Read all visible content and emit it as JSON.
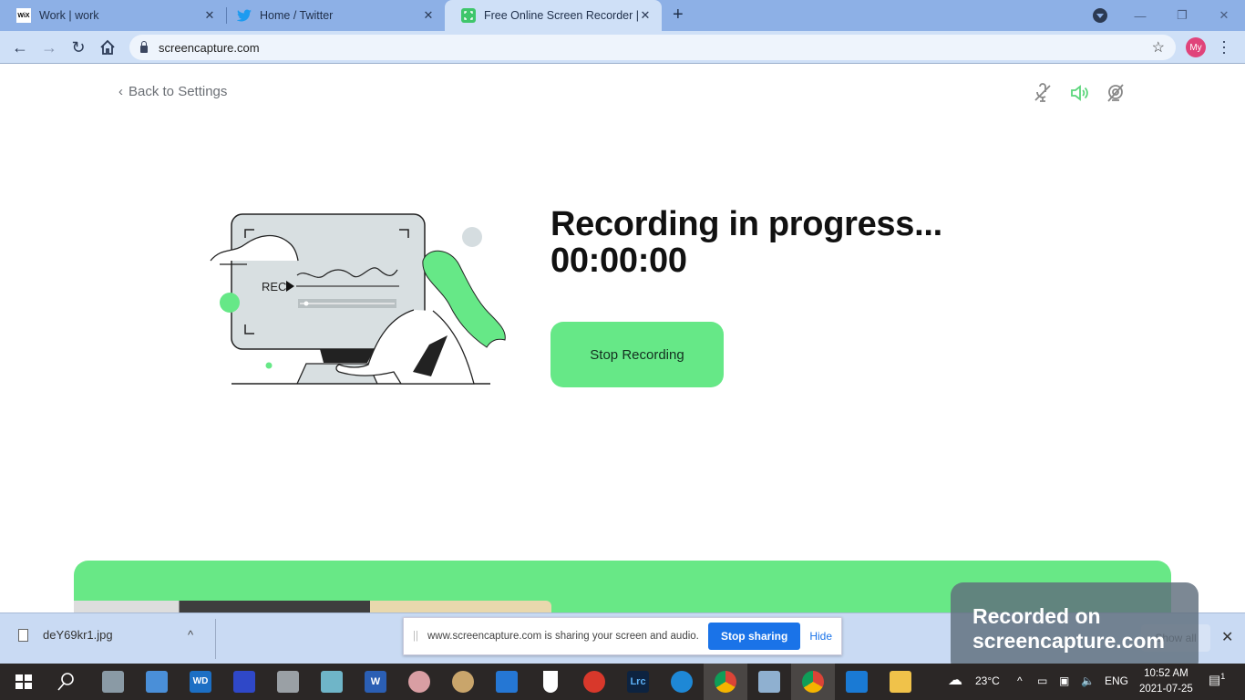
{
  "browser": {
    "tabs": [
      {
        "title": "Work | work",
        "favicon": "wix-icon",
        "active": false
      },
      {
        "title": "Home / Twitter",
        "favicon": "twitter-icon",
        "active": false
      },
      {
        "title": "Free Online Screen Recorder | Fre",
        "favicon": "screencapture-icon",
        "active": true
      }
    ],
    "url": "screencapture.com",
    "profile_initials": "My"
  },
  "page": {
    "back_link": "Back to Settings",
    "heading_line1": "Recording in progress...",
    "timer": "00:00:00",
    "stop_button": "Stop Recording",
    "illustration_label": "REC",
    "controls": [
      "mic-muted-icon",
      "speaker-icon",
      "camera-off-icon"
    ],
    "accent_color": "#66e887"
  },
  "download_bar": {
    "file_name": "deY69kr1.jpg",
    "show_all": "Show all"
  },
  "share_notice": {
    "message": "www.screencapture.com is sharing your screen and audio.",
    "stop_sharing": "Stop sharing",
    "hide": "Hide"
  },
  "watermark": {
    "line1": "Recorded on",
    "line2": "screencapture.com"
  },
  "taskbar": {
    "weather": "23°C",
    "language": "ENG",
    "time": "10:52 AM",
    "date": "2021-07-25",
    "notifications": "1"
  }
}
